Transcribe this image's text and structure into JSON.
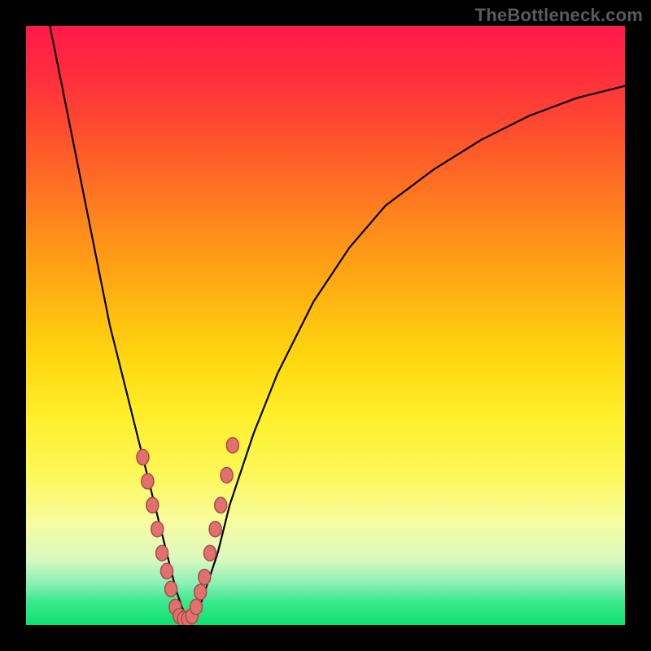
{
  "watermark": "TheBottleneck.com",
  "chart_data": {
    "type": "line",
    "title": "",
    "xlabel": "",
    "ylabel": "",
    "xlim": [
      0,
      100
    ],
    "ylim": [
      0,
      100
    ],
    "grid": false,
    "legend": false,
    "series": [
      {
        "name": "curve",
        "x": [
          4,
          6,
          8,
          10,
          12,
          14,
          16,
          18,
          20,
          22,
          23,
          24,
          25,
          26,
          27,
          28,
          29,
          30,
          32,
          34,
          38,
          42,
          48,
          54,
          60,
          68,
          76,
          84,
          92,
          100
        ],
        "y": [
          100,
          90,
          80,
          70,
          60,
          50,
          42,
          34,
          26,
          18,
          14,
          10,
          6,
          3,
          1,
          1,
          3,
          6,
          12,
          20,
          32,
          42,
          54,
          63,
          70,
          76,
          81,
          85,
          88,
          90
        ]
      }
    ],
    "points": {
      "name": "marker-dots",
      "x": [
        19.5,
        20.3,
        21.1,
        21.9,
        22.7,
        23.5,
        24.2,
        24.9,
        25.6,
        26.3,
        27.0,
        27.7,
        28.4,
        29.1,
        29.8,
        30.7,
        31.6,
        32.5,
        33.5,
        34.5
      ],
      "y": [
        28,
        24,
        20,
        16,
        12,
        9,
        6,
        3,
        1.5,
        1,
        1,
        1.5,
        3,
        5.5,
        8,
        12,
        16,
        20,
        25,
        30
      ]
    },
    "background_gradient": {
      "direction": "vertical",
      "stops": [
        {
          "pos": 0.0,
          "color": "#ff1a4a"
        },
        {
          "pos": 0.25,
          "color": "#ff6a25"
        },
        {
          "pos": 0.55,
          "color": "#ffd60f"
        },
        {
          "pos": 0.83,
          "color": "#f7fca0"
        },
        {
          "pos": 1.0,
          "color": "#0be36f"
        }
      ]
    }
  }
}
